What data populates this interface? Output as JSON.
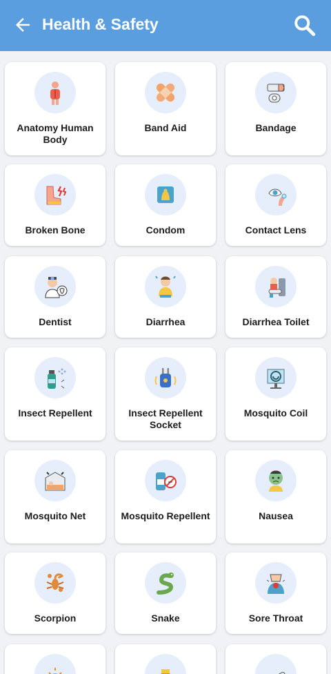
{
  "header": {
    "title": "Health & Safety",
    "bg_color": "#5b9ee0"
  },
  "items": [
    {
      "label": "Anatomy Human Body",
      "icon": "anatomy-icon"
    },
    {
      "label": "Band Aid",
      "icon": "band-aid-icon"
    },
    {
      "label": "Bandage",
      "icon": "bandage-icon"
    },
    {
      "label": "Broken Bone",
      "icon": "broken-bone-icon"
    },
    {
      "label": "Condom",
      "icon": "condom-icon"
    },
    {
      "label": "Contact Lens",
      "icon": "contact-lens-icon"
    },
    {
      "label": "Dentist",
      "icon": "dentist-icon"
    },
    {
      "label": "Diarrhea",
      "icon": "diarrhea-icon"
    },
    {
      "label": "Diarrhea Toilet",
      "icon": "diarrhea-toilet-icon"
    },
    {
      "label": "Insect Repellent",
      "icon": "insect-repellent-icon"
    },
    {
      "label": "Insect Repellent Socket",
      "icon": "insect-repellent-socket-icon"
    },
    {
      "label": "Mosquito Coil",
      "icon": "mosquito-coil-icon"
    },
    {
      "label": "Mosquito Net",
      "icon": "mosquito-net-icon"
    },
    {
      "label": "Mosquito Repellent",
      "icon": "mosquito-repellent-icon"
    },
    {
      "label": "Nausea",
      "icon": "nausea-icon"
    },
    {
      "label": "Scorpion",
      "icon": "scorpion-icon"
    },
    {
      "label": "Snake",
      "icon": "snake-icon"
    },
    {
      "label": "Sore Throat",
      "icon": "sore-throat-icon"
    },
    {
      "label": "",
      "icon": "sun-icon"
    },
    {
      "label": "",
      "icon": "medicine-icon"
    },
    {
      "label": "",
      "icon": "thermometer-icon"
    }
  ]
}
